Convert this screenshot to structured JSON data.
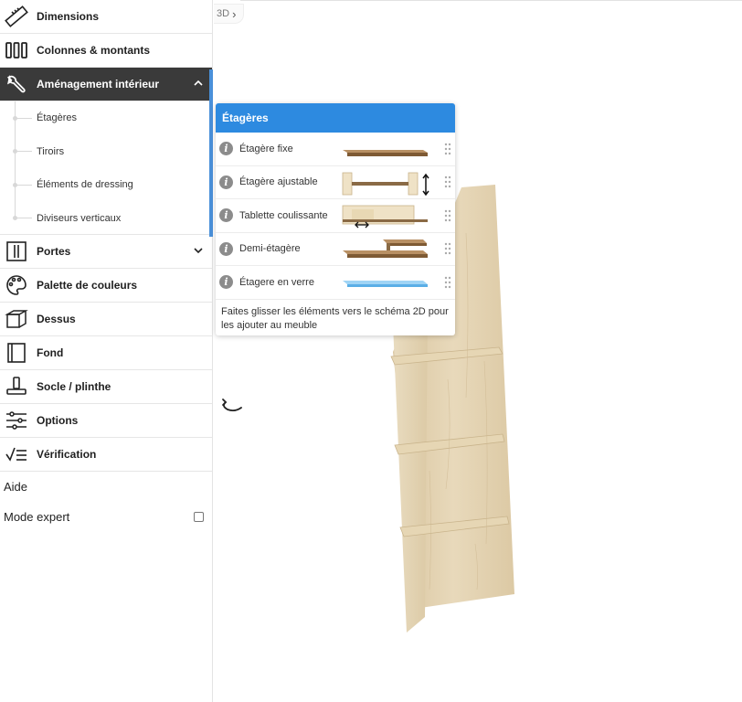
{
  "sidebar": {
    "items": [
      {
        "label": "Dimensions",
        "icon": "ruler-icon"
      },
      {
        "label": "Colonnes & montants",
        "icon": "columns-icon"
      },
      {
        "label": "Aménagement intérieur",
        "icon": "wrench-icon",
        "active": true
      },
      {
        "label": "Portes",
        "icon": "door-icon"
      },
      {
        "label": "Palette de couleurs",
        "icon": "palette-icon"
      },
      {
        "label": "Dessus",
        "icon": "top-box-icon"
      },
      {
        "label": "Fond",
        "icon": "back-panel-icon"
      },
      {
        "label": "Socle / plinthe",
        "icon": "plinth-icon"
      },
      {
        "label": "Options",
        "icon": "sliders-icon"
      },
      {
        "label": "Vérification",
        "icon": "checklist-icon"
      }
    ],
    "sub_items": [
      "Étagères",
      "Tiroirs",
      "Éléments de dressing",
      "Diviseurs verticaux"
    ],
    "help_label": "Aide",
    "expert_mode_label": "Mode expert",
    "expert_mode_checked": false
  },
  "canvas": {
    "view_toggle_label": "3D",
    "chevron": "›"
  },
  "popup": {
    "title": "Étagères",
    "rows": [
      {
        "label": "Étagère fixe",
        "thumb": "fixed-shelf"
      },
      {
        "label": "Étagère ajustable",
        "thumb": "adjustable-shelf"
      },
      {
        "label": "Tablette coulissante",
        "thumb": "sliding-shelf"
      },
      {
        "label": "Demi-étagère",
        "thumb": "half-shelf"
      },
      {
        "label": "Étagere en verre",
        "thumb": "glass-shelf"
      }
    ],
    "info_glyph": "i",
    "footer": "Faites glisser les éléments vers le schéma 2D pour les ajouter au meuble"
  },
  "colors": {
    "accent_blue": "#2d8ae0",
    "active_bg": "#3a3a3a",
    "active_bar": "#4a90d9",
    "wood": "#e3d3b1",
    "shelf_brown": "#8a6a45",
    "glass": "#8cc8f0"
  }
}
